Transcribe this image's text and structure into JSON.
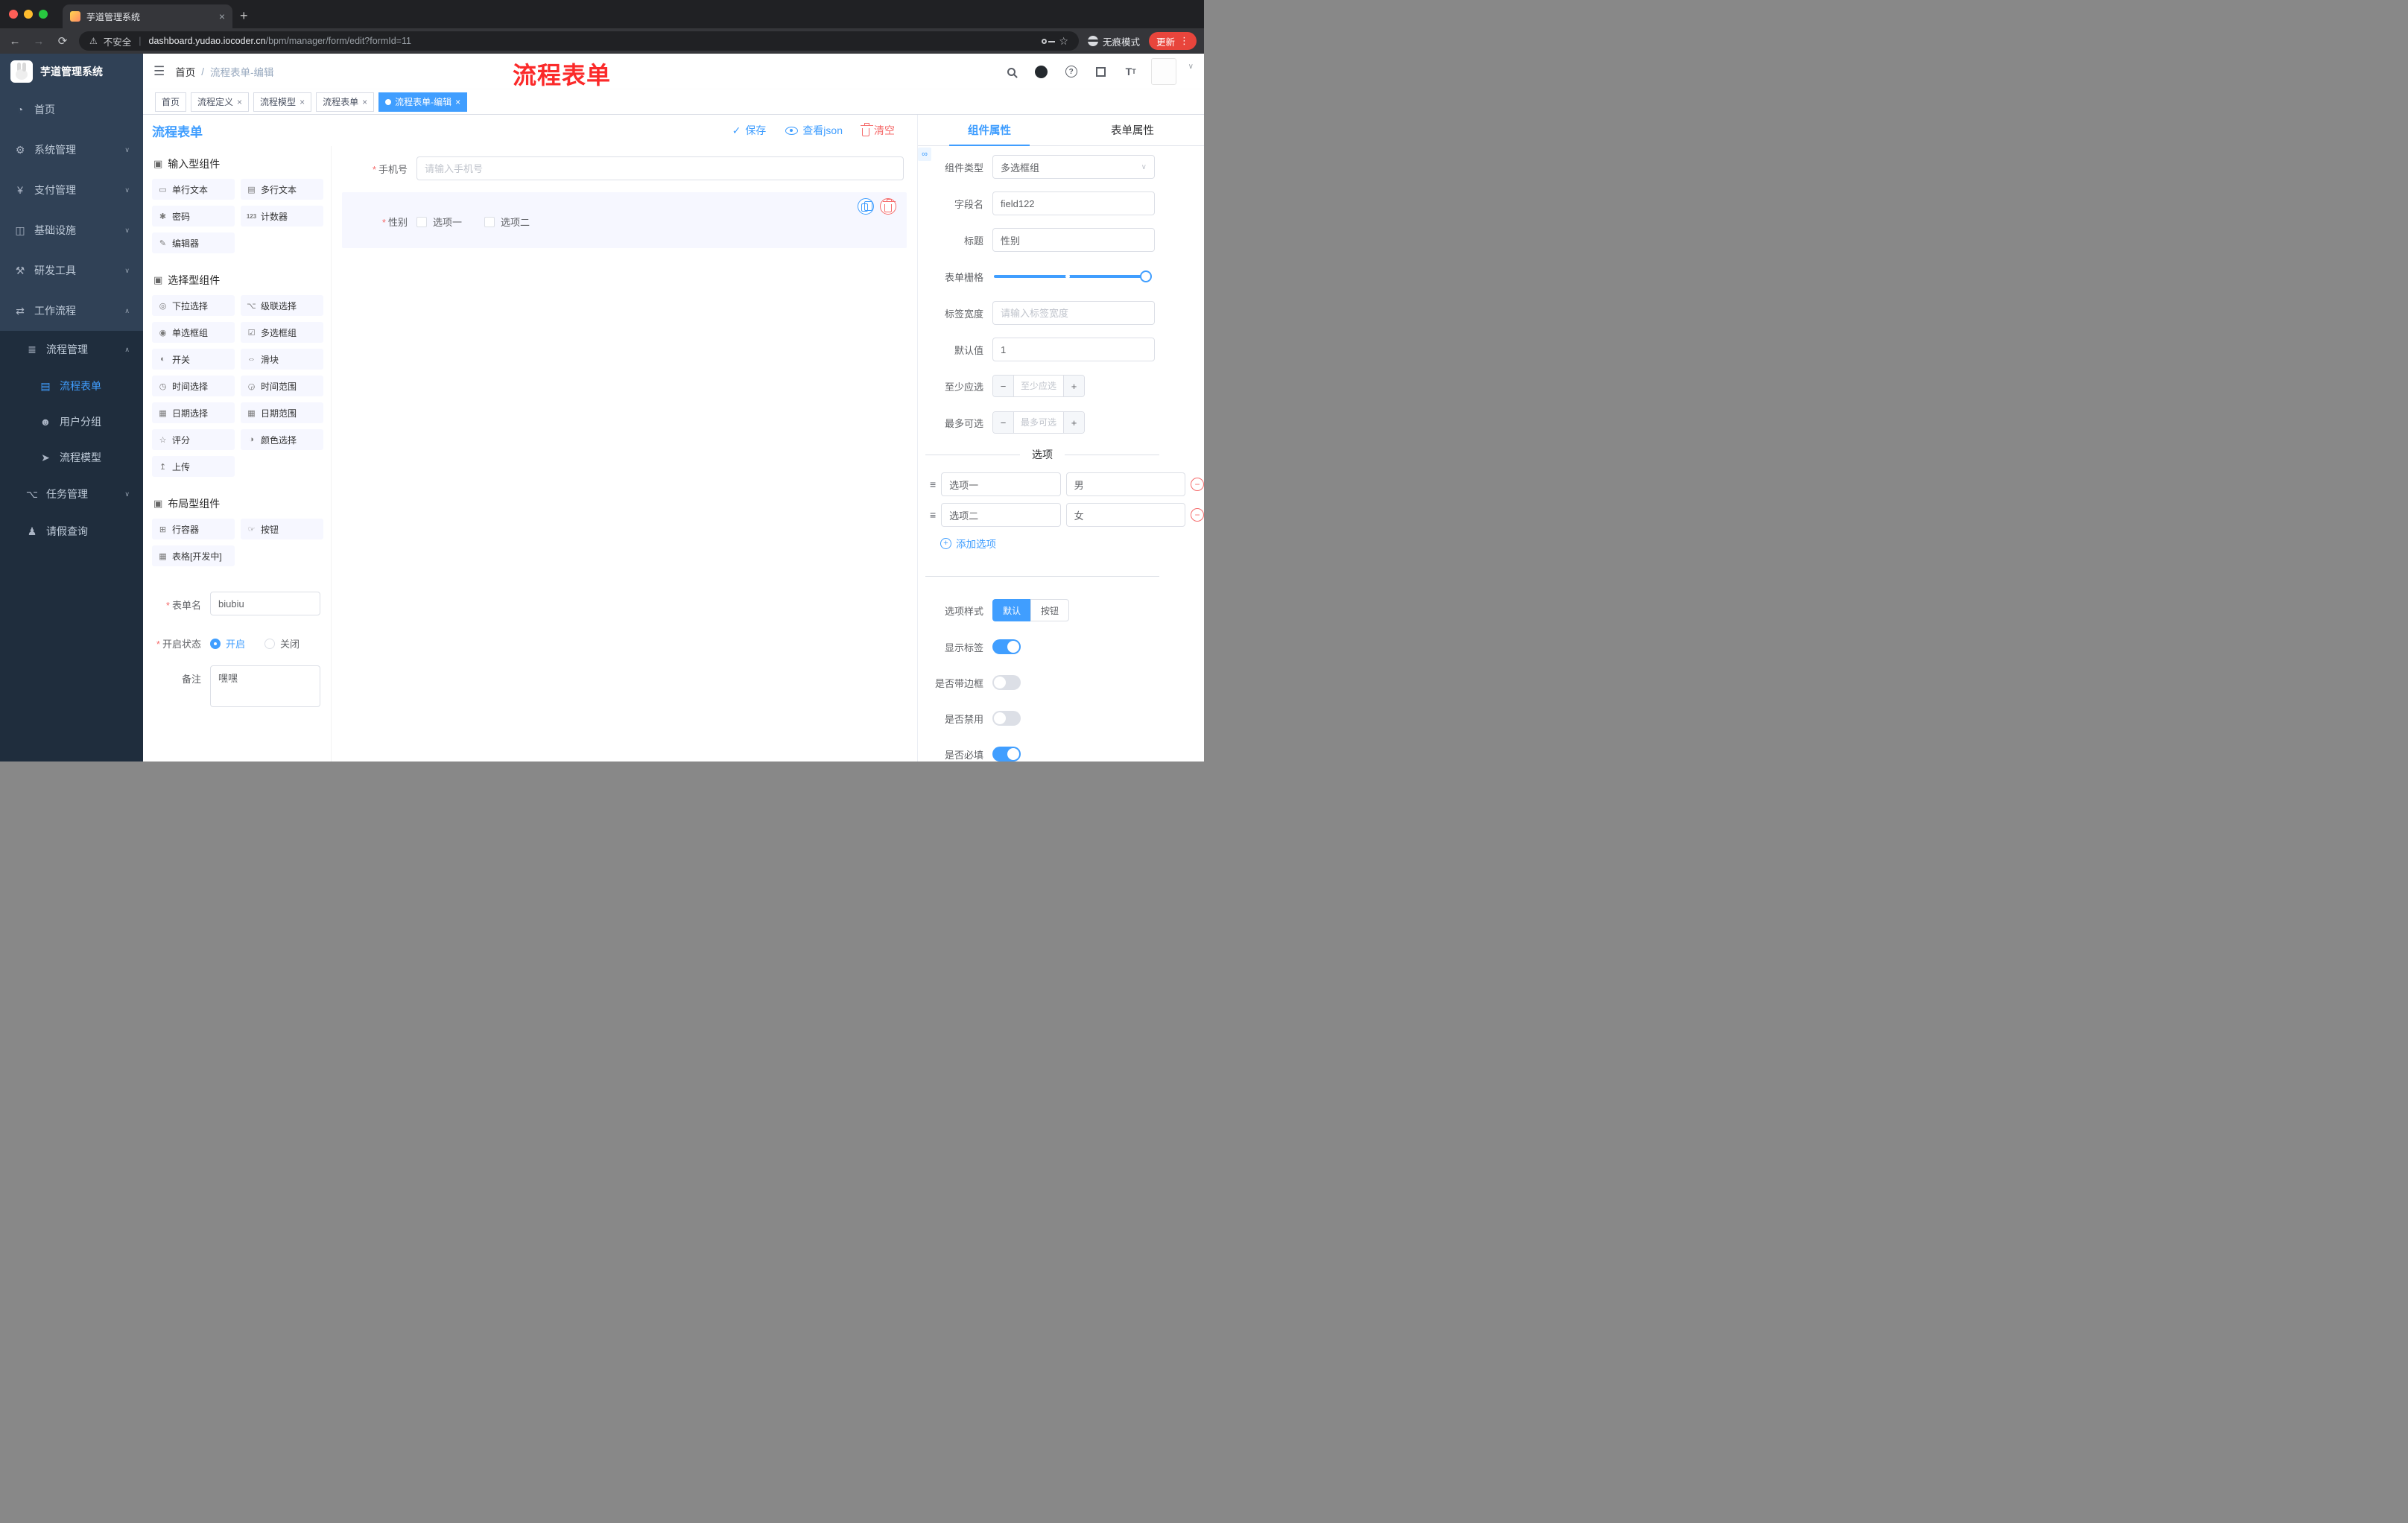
{
  "glyphs": {
    "hamburger": "☰",
    "back": "←",
    "forward": "→",
    "reload": "⟳",
    "warning": "⚠",
    "star": "☆",
    "plus": "+",
    "minus": "−",
    "close": "×",
    "dots": "⋮",
    "check": "✓",
    "caret_down": "∨",
    "caret_up": "∧",
    "question": "?",
    "link": "∞",
    "option_handle": "≡",
    "font_big": "T",
    "font_small": "T",
    "menu_home": "◔",
    "menu_system": "⚙",
    "menu_pay": "¥",
    "menu_infra": "◫",
    "menu_dev": "⚒",
    "menu_flow": "⇄",
    "menu_flowmgr": "≣",
    "menu_form": "▤",
    "menu_group": "☻",
    "menu_model": "➤",
    "menu_task": "⌥",
    "menu_leave": "♟",
    "cube": "▣",
    "c_input": "▭",
    "c_textarea": "▤",
    "c_password": "✱",
    "c_counter": "123",
    "c_editor": "✎",
    "c_select": "◎",
    "c_cascade": "⌥",
    "c_radio": "◉",
    "c_checkbox": "☑",
    "c_switch": "◐",
    "c_slider": "⇔",
    "c_time": "◷",
    "c_timerange": "◶",
    "c_date": "▦",
    "c_daterange": "▦",
    "c_rate": "☆",
    "c_color": "◑",
    "c_upload": "↥",
    "c_row": "⊞",
    "c_button": "☞",
    "c_table": "▦"
  },
  "browser": {
    "tab_title": "芋道管理系统",
    "security_label": "不安全",
    "url_domain": "dashboard.yudao.iocoder.cn",
    "url_path": "/bpm/manager/form/edit?formId=11",
    "incognito_label": "无痕模式",
    "update_label": "更新"
  },
  "header": {
    "breadcrumb_home": "首页",
    "breadcrumb_sep": "/",
    "breadcrumb_current": "流程表单-编辑",
    "overlay_title": "流程表单"
  },
  "sidebar": {
    "brand": "芋道管理系统",
    "items": [
      {
        "label": "首页"
      },
      {
        "label": "系统管理"
      },
      {
        "label": "支付管理"
      },
      {
        "label": "基础设施"
      },
      {
        "label": "研发工具"
      },
      {
        "label": "工作流程"
      },
      {
        "label": "流程管理"
      },
      {
        "label": "流程表单"
      },
      {
        "label": "用户分组"
      },
      {
        "label": "流程模型"
      },
      {
        "label": "任务管理"
      },
      {
        "label": "请假查询"
      }
    ]
  },
  "tags": [
    {
      "label": "首页"
    },
    {
      "label": "流程定义"
    },
    {
      "label": "流程模型"
    },
    {
      "label": "流程表单"
    },
    {
      "label": "流程表单-编辑"
    }
  ],
  "designer": {
    "title": "流程表单",
    "save_label": "保存",
    "view_json_label": "查看json",
    "clear_label": "清空",
    "groups": [
      {
        "title": "输入型组件",
        "items": [
          "单行文本",
          "多行文本",
          "密码",
          "计数器",
          "编辑器"
        ]
      },
      {
        "title": "选择型组件",
        "items": [
          "下拉选择",
          "级联选择",
          "单选框组",
          "多选框组",
          "开关",
          "滑块",
          "时间选择",
          "时间范围",
          "日期选择",
          "日期范围",
          "评分",
          "颜色选择",
          "上传"
        ]
      },
      {
        "title": "布局型组件",
        "items": [
          "行容器",
          "按钮",
          "表格[开发中]"
        ]
      }
    ],
    "meta": {
      "name_label": "表单名",
      "name_value": "biubiu",
      "status_label": "开启状态",
      "status_on": "开启",
      "status_off": "关闭",
      "remark_label": "备注",
      "remark_value": "嘿嘿"
    },
    "canvas": {
      "phone_label": "手机号",
      "phone_placeholder": "请输入手机号",
      "gender_label": "性别",
      "gender_option1": "选项一",
      "gender_option2": "选项二"
    }
  },
  "props": {
    "tab_component": "组件属性",
    "tab_form": "表单属性",
    "component_type_label": "组件类型",
    "component_type_value": "多选框组",
    "field_label": "字段名",
    "field_value": "field122",
    "title_label": "标题",
    "title_value": "性别",
    "grid_label": "表单栅格",
    "label_width_label": "标签宽度",
    "label_width_placeholder": "请输入标签宽度",
    "default_label": "默认值",
    "default_value": "1",
    "min_label": "至少应选",
    "min_placeholder": "至少应选",
    "max_label": "最多可选",
    "max_placeholder": "最多可选",
    "options_divider": "选项",
    "options": [
      {
        "label": "选项一",
        "value": "男"
      },
      {
        "label": "选项二",
        "value": "女"
      }
    ],
    "add_option_label": "添加选项",
    "style_label": "选项样式",
    "style_default": "默认",
    "style_button": "按钮",
    "toggle_show_label": "显示标签",
    "toggle_border_label": "是否带边框",
    "toggle_disabled_label": "是否禁用",
    "toggle_required_label": "是否必填"
  },
  "colors": {
    "accent": "#409eff",
    "danger": "#f56c6c",
    "annotation_red": "#fb2a2a",
    "sidebar_bg": "#304156",
    "sidebar_sub_bg": "#1f2d3d"
  }
}
